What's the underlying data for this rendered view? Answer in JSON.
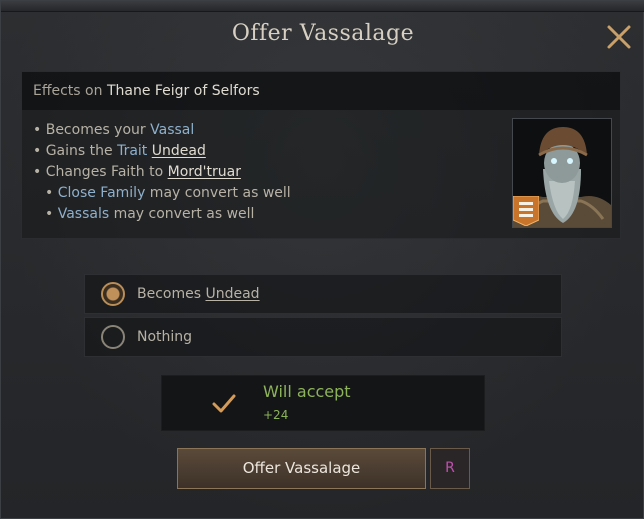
{
  "window": {
    "title": "Offer Vassalage"
  },
  "effects": {
    "header_prefix": "Effects on",
    "target_name": "Thane Feigr of Selfors",
    "lines": [
      {
        "pre": "• Becomes your ",
        "link": "Vassal",
        "post": ""
      },
      {
        "pre": "• Gains the ",
        "link": "Trait",
        "mid": " ",
        "ul": "Undead"
      },
      {
        "pre": "• Changes Faith to ",
        "ul": "Mord'truar"
      },
      {
        "pre": "• ",
        "link": "Close Family",
        "post": " may convert as well"
      },
      {
        "pre": "• ",
        "link": "Vassals",
        "post": " may convert as well"
      }
    ]
  },
  "options": [
    {
      "prefix": "Becomes ",
      "underlined": "Undead",
      "selected": true
    },
    {
      "prefix": "Nothing",
      "underlined": "",
      "selected": false
    }
  ],
  "acceptance": {
    "status": "Will accept",
    "score": "+24",
    "color": "#8db35a"
  },
  "actions": {
    "confirm_label": "Offer Vassalage",
    "hotkey": "R"
  },
  "icons": {
    "close": "close-icon",
    "check": "checkmark-icon",
    "rank": "rank-badge-icon"
  }
}
